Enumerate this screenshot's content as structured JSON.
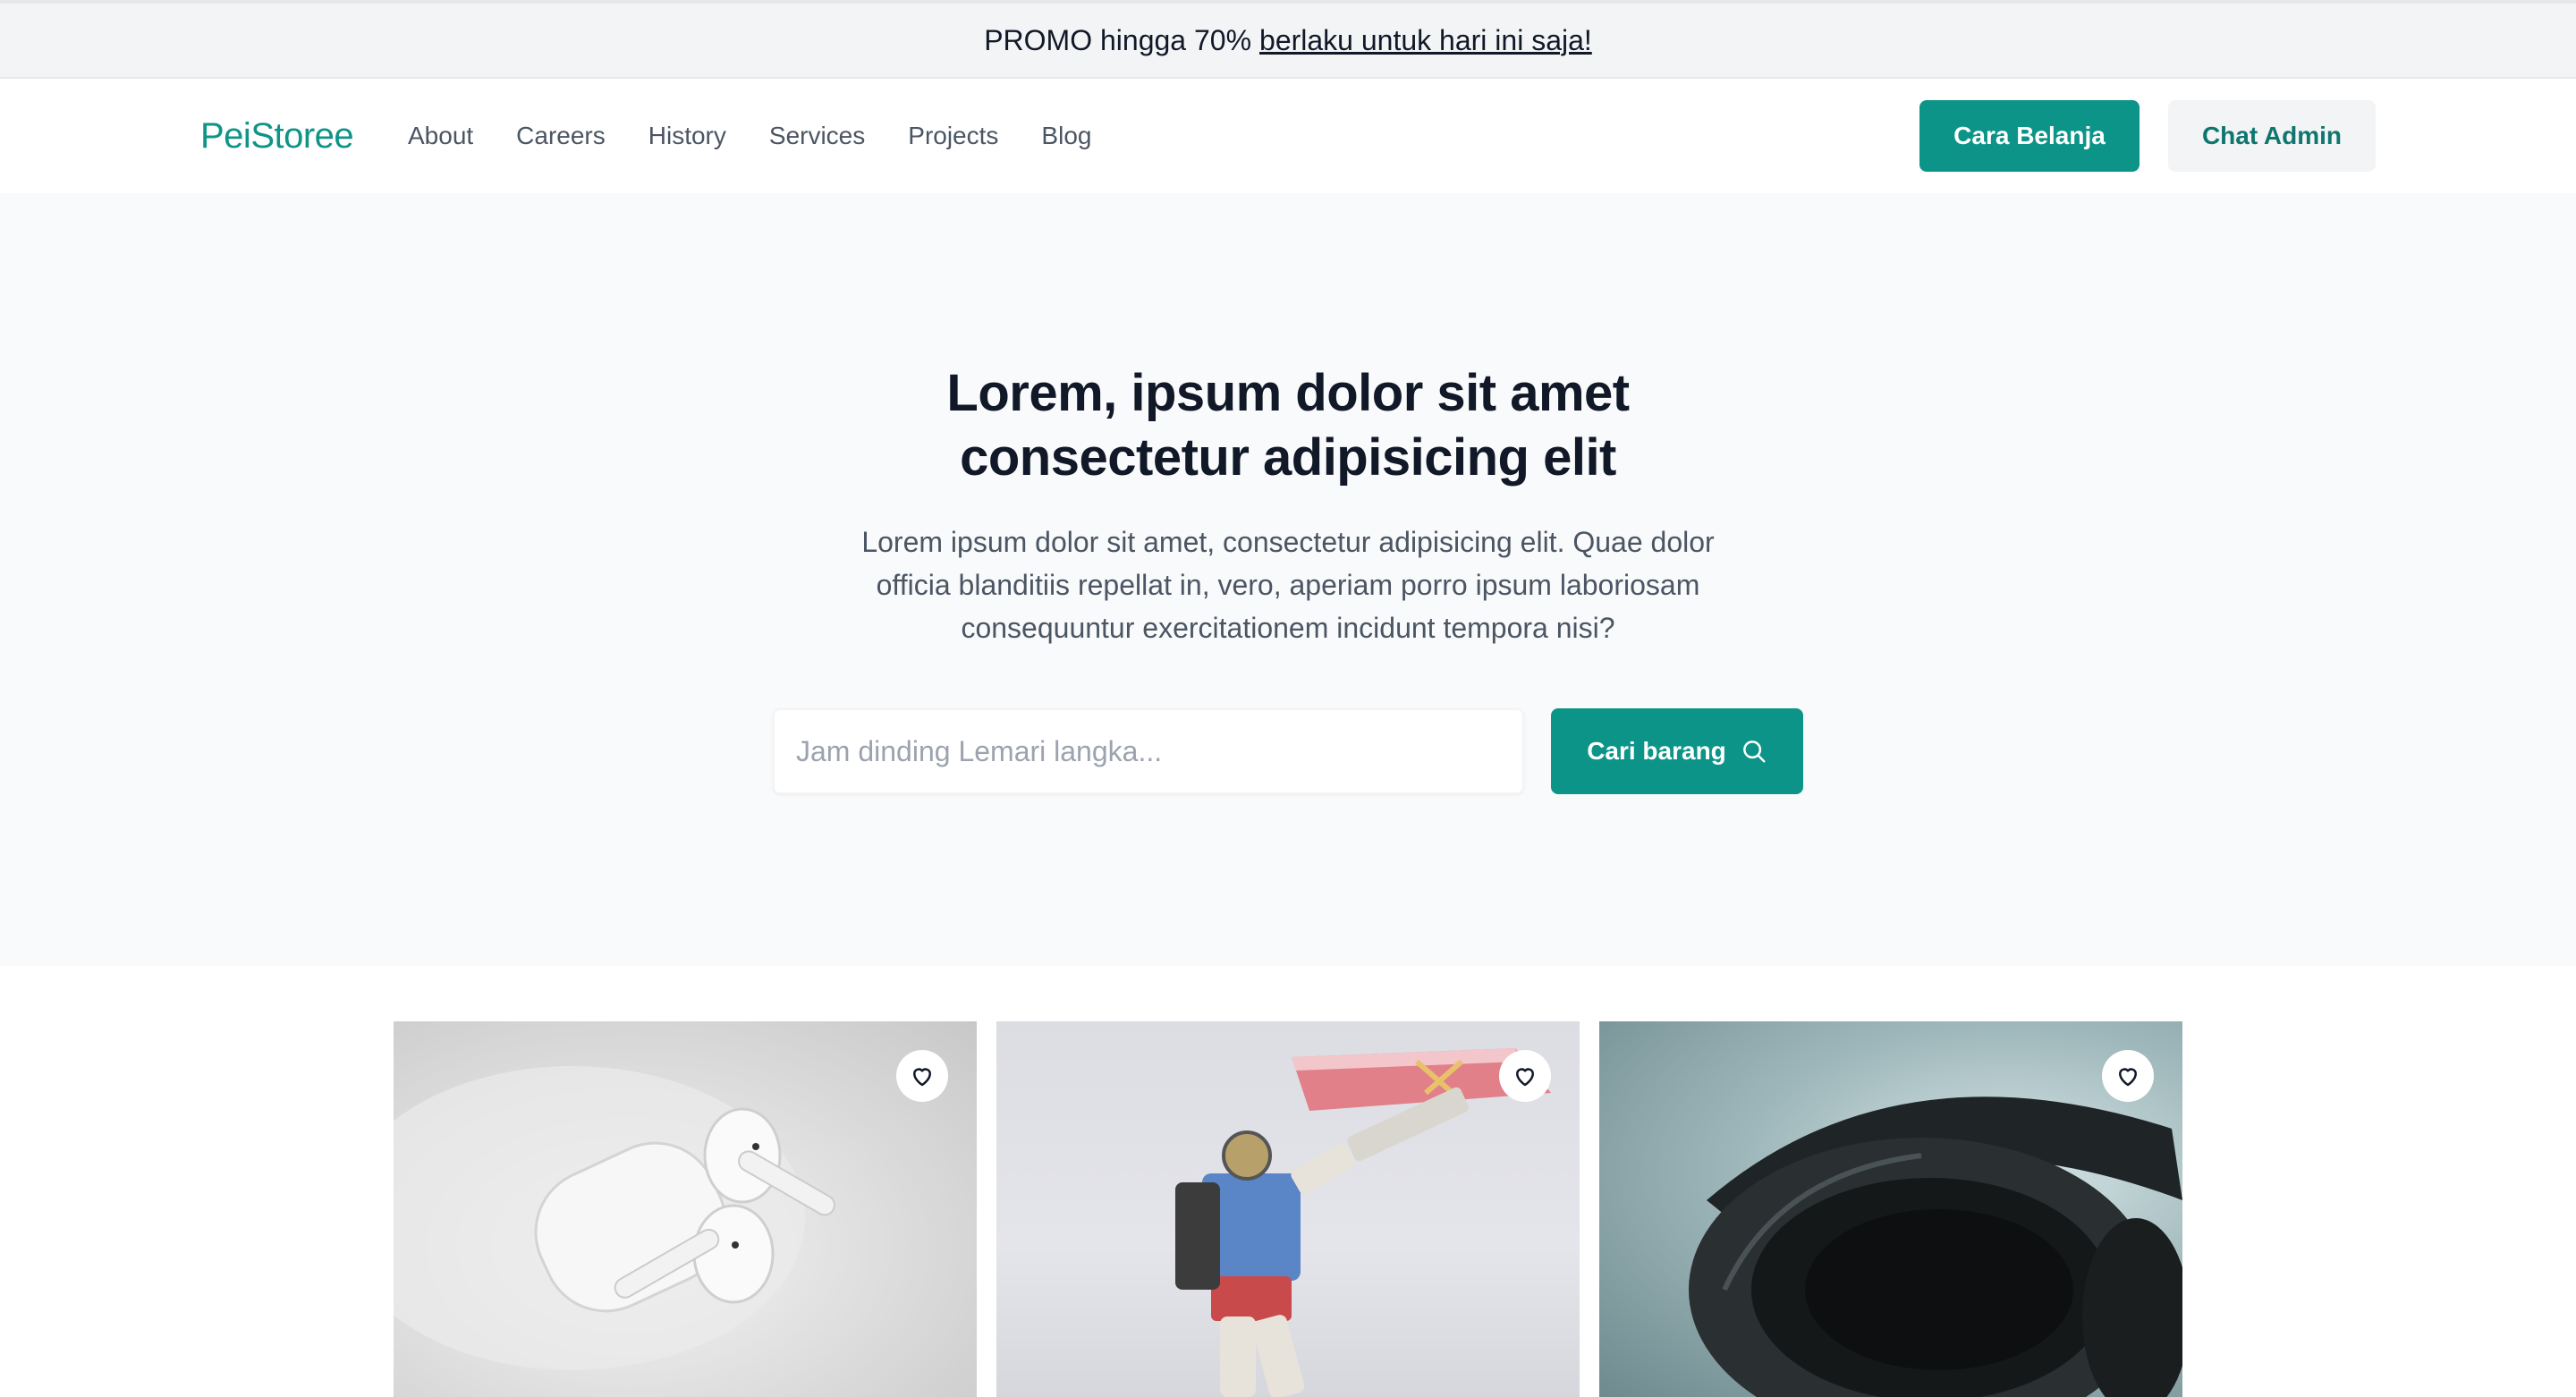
{
  "promo": {
    "text": "PROMO hingga 70%",
    "link": "berlaku untuk hari ini saja!"
  },
  "nav": {
    "logo": "PeiStoree",
    "links": [
      "About",
      "Careers",
      "History",
      "Services",
      "Projects",
      "Blog"
    ],
    "primary_button": "Cara Belanja",
    "secondary_button": "Chat Admin"
  },
  "hero": {
    "title_line1": "Lorem, ipsum dolor sit amet",
    "title_line2": "consectetur adipisicing elit",
    "subtitle_line1": "Lorem ipsum dolor sit amet, consectetur adipisicing elit. Quae dolor",
    "subtitle_line2": "officia blanditiis repellat in, vero, aperiam porro ipsum laboriosam",
    "subtitle_line3": "consequuntur exercitationem incidunt tempora nisi?",
    "search_placeholder": "Jam dinding Lemari langka...",
    "search_button": "Cari barang"
  },
  "products": [
    {
      "image": "white-earbuds-photo",
      "favorite_icon": "heart-icon"
    },
    {
      "image": "robot-figure-photo",
      "favorite_icon": "heart-icon"
    },
    {
      "image": "black-headphones-photo",
      "favorite_icon": "heart-icon"
    }
  ],
  "colors": {
    "accent": "#0d9488",
    "promo_bg": "#f3f4f6",
    "hero_bg": "#f9fafb",
    "secondary_button_bg": "#f3f4f6"
  }
}
